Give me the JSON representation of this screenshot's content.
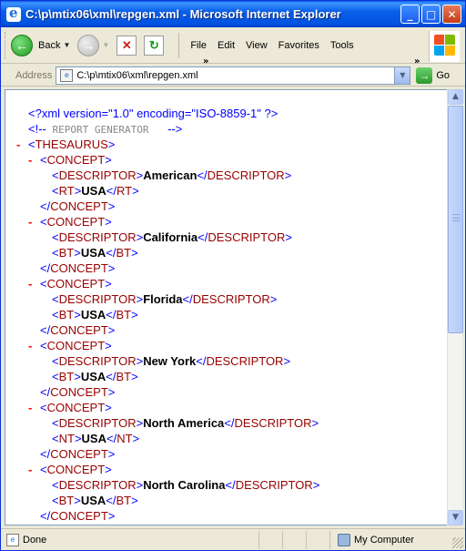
{
  "window": {
    "title": "C:\\p\\mtix06\\xml\\repgen.xml - Microsoft Internet Explorer",
    "caption_buttons": [
      "minimize",
      "maximize",
      "close"
    ]
  },
  "toolbar": {
    "back_label": "Back",
    "menu": [
      "File",
      "Edit",
      "View",
      "Favorites",
      "Tools"
    ],
    "chevron": "»"
  },
  "address": {
    "label": "Address",
    "value": "C:\\p\\mtix06\\xml\\repgen.xml",
    "go_label": "Go"
  },
  "xml": {
    "declaration": "<?xml version=\"1.0\" encoding=\"ISO-8859-1\" ?>",
    "comment_open": "<!--",
    "comment_text": " REPORT GENERATOR ",
    "comment_close": "-->",
    "root_tag": "THESAURUS",
    "concept_tag": "CONCEPT",
    "descriptor_tag": "DESCRIPTOR",
    "concepts": [
      {
        "descriptor": "American",
        "rel": "RT",
        "value": "USA"
      },
      {
        "descriptor": "California",
        "rel": "BT",
        "value": "USA"
      },
      {
        "descriptor": "Florida",
        "rel": "BT",
        "value": "USA"
      },
      {
        "descriptor": "New York",
        "rel": "BT",
        "value": "USA"
      },
      {
        "descriptor": "North America",
        "rel": "NT",
        "value": "USA"
      },
      {
        "descriptor": "North Carolina",
        "rel": "BT",
        "value": "USA"
      }
    ],
    "minus_sign": "-"
  },
  "status": {
    "text": "Done",
    "zone": "My Computer"
  },
  "colors": {
    "title_bar": "#0a5fe8",
    "xml_markup": "#0000ff",
    "xml_tag_name": "#990000",
    "xml_minus": "#ff0000"
  }
}
